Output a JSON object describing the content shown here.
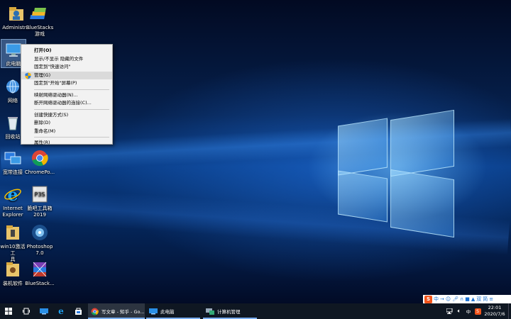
{
  "desktop_icons": [
    {
      "label": "Administr...",
      "icon": "user-folder-icon"
    },
    {
      "label": "BlueStacks\n游戏",
      "icon": "bluestacks-icon"
    },
    {
      "label": "此电脑",
      "icon": "this-pc-icon"
    },
    {
      "label": "网络",
      "icon": "network-icon"
    },
    {
      "label": "回收站",
      "icon": "recycle-bin-icon"
    },
    {
      "label": "宽带连接",
      "icon": "broadband-icon"
    },
    {
      "label": "ChromePo...",
      "icon": "chrome-icon"
    },
    {
      "label": "Internet\nExplorer",
      "icon": "ie-icon"
    },
    {
      "label": "脆吧工具箱\n2019",
      "icon": "toolbox-icon"
    },
    {
      "label": "win10激活工\n具",
      "icon": "activator-folder-icon"
    },
    {
      "label": "Photoshop\n7.0",
      "icon": "photoshop-icon"
    },
    {
      "label": "装机软件",
      "icon": "software-folder-icon"
    },
    {
      "label": "BlueStack...",
      "icon": "bluestacks-multi-icon"
    }
  ],
  "context_menu": {
    "items": [
      {
        "label": "打开(O)",
        "bold": true
      },
      {
        "label": "显示/不显示 隐藏的文件"
      },
      {
        "label": "固定到\"快速访问\""
      },
      {
        "label": "管理(G)",
        "highlighted": true,
        "icon": "shield-icon"
      },
      {
        "label": "固定到\"开始\"屏幕(P)"
      },
      {
        "label": "映射网络驱动器(N)..."
      },
      {
        "label": "断开网络驱动器的连接(C)..."
      },
      {
        "label": "创建快捷方式(S)"
      },
      {
        "label": "删除(D)"
      },
      {
        "label": "重命名(M)"
      },
      {
        "label": "属性(R)"
      }
    ]
  },
  "taskbar": {
    "tasks": [
      {
        "label": "写文章 - 知乎 - Go...",
        "icon": "chrome-icon"
      },
      {
        "label": "此电脑",
        "icon": "this-pc-icon"
      },
      {
        "label": "计算机管理",
        "icon": "computer-management-icon"
      }
    ],
    "tray": {
      "time": "22:01",
      "date": "2020/7/6",
      "lang": "中"
    }
  },
  "ime_bar": {
    "chars": [
      "中",
      "双",
      "简"
    ]
  }
}
